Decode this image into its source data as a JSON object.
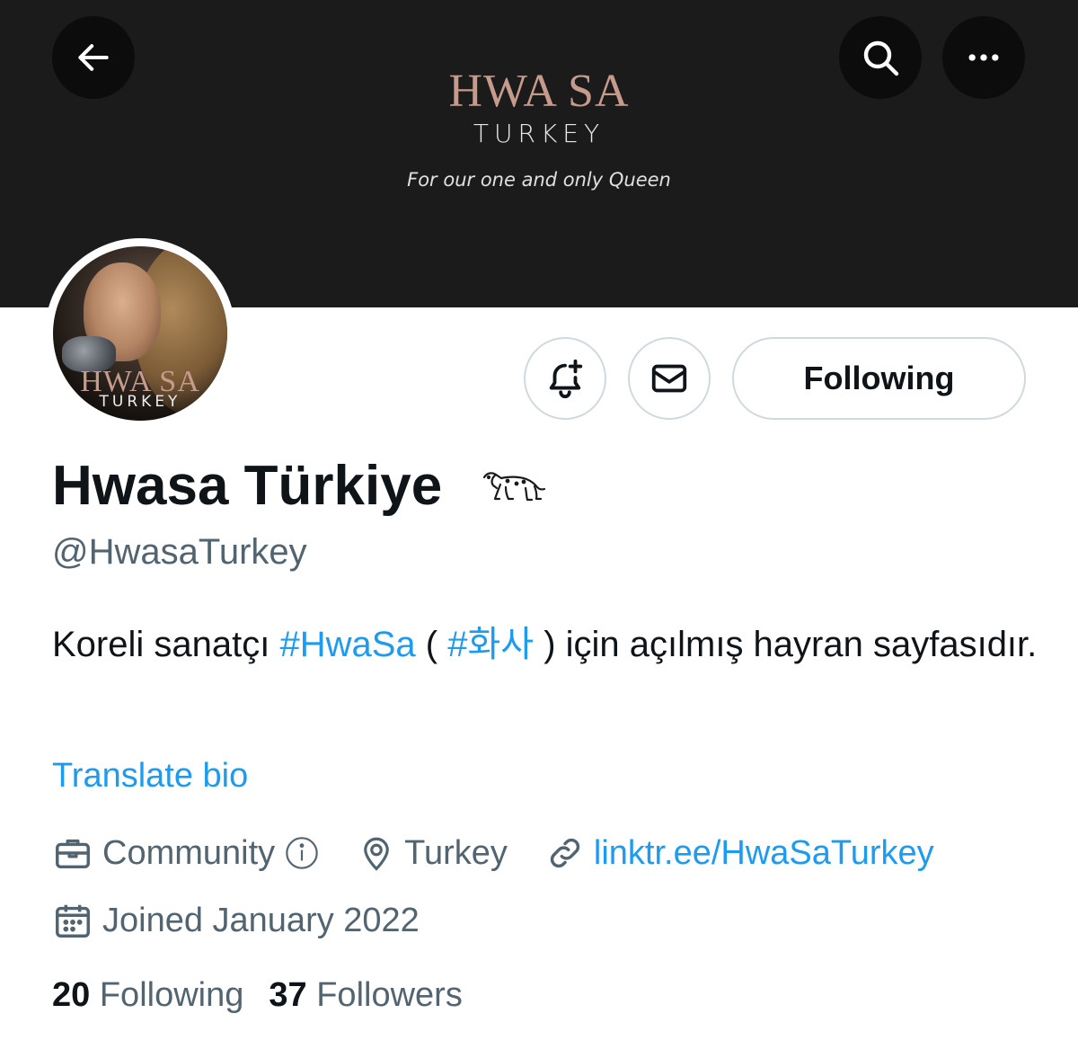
{
  "banner": {
    "logo_top": "HWA SA",
    "logo_bottom": "TURKEY",
    "tagline": "For our one and only Queen",
    "accent_color": "#c79b8c",
    "background_color": "#1b1b1b"
  },
  "header_buttons": {
    "back_icon": "arrow-left-icon",
    "search_icon": "search-icon",
    "more_icon": "more-horizontal-icon"
  },
  "avatar": {
    "logo_top": "HWA SA",
    "logo_bottom": "TURKEY"
  },
  "actions": {
    "notify_icon": "bell-plus-icon",
    "message_icon": "envelope-icon",
    "following_label": "Following"
  },
  "profile": {
    "display_name": "Hwasa Türkiye",
    "name_emoji": "🐆",
    "handle": "@HwasaTurkey",
    "bio_part1": "Koreli sanatçı ",
    "bio_tag1": "#HwaSa",
    "bio_part2": " ( ",
    "bio_tag2": "#화사",
    "bio_part3": " ) için açılmış hayran sayfasıdır.",
    "translate_label": "Translate bio"
  },
  "meta": {
    "category": "Community",
    "location": "Turkey",
    "link": "linktr.ee/HwaSaTurkey",
    "joined": "Joined January 2022"
  },
  "stats": {
    "following_count": "20",
    "following_label": "Following",
    "followers_count": "37",
    "followers_label": "Followers"
  },
  "colors": {
    "link_blue": "#1d9bf0",
    "secondary_text": "#536471",
    "border": "#cfd9de"
  }
}
